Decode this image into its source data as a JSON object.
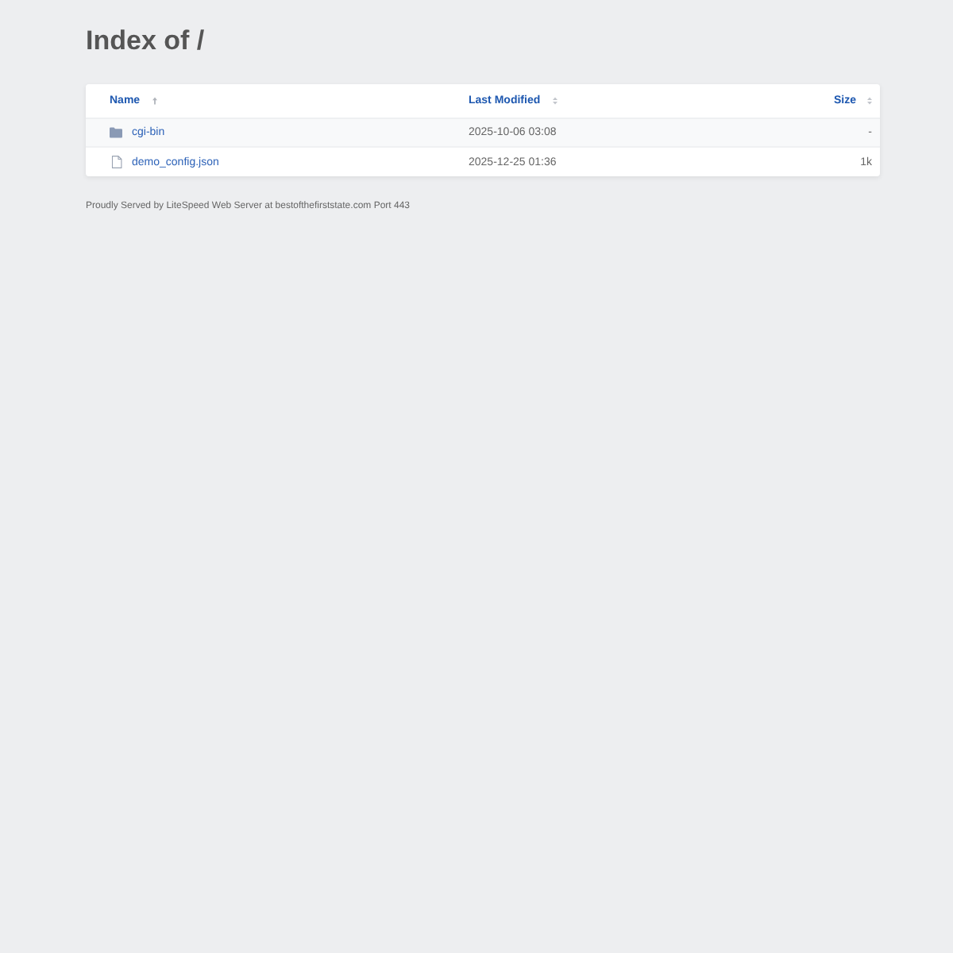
{
  "title": "Index of /",
  "table": {
    "columns": [
      {
        "label": "Name",
        "sorted": true
      },
      {
        "label": "Last Modified",
        "sorted": false
      },
      {
        "label": "Size",
        "sorted": false
      }
    ],
    "rows": [
      {
        "kind": "folder",
        "name": "cgi-bin",
        "modified": "2025-10-06 03:08",
        "size": "-"
      },
      {
        "kind": "file",
        "name": "demo_config.json",
        "modified": "2025-12-25 01:36",
        "size": "1k"
      }
    ]
  },
  "footer": "Proudly Served by LiteSpeed Web Server at bestofthefirststate.com Port 443"
}
